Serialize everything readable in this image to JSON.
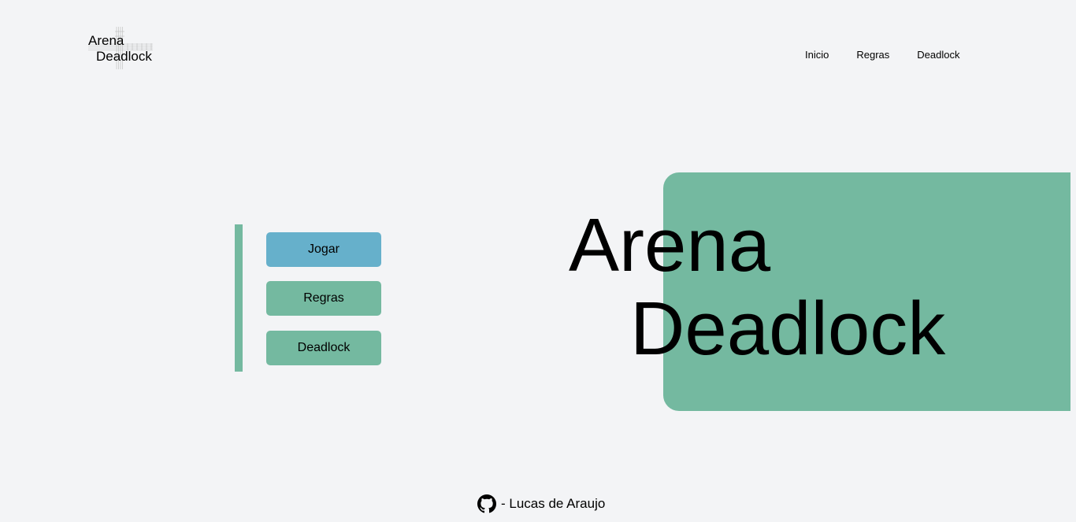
{
  "header": {
    "logo_line1": "Arena",
    "logo_line2": "Deadlock",
    "nav": [
      "Inicio",
      "Regras",
      "Deadlock"
    ]
  },
  "menu": {
    "buttons": [
      "Jogar",
      "Regras",
      "Deadlock"
    ]
  },
  "hero": {
    "line1": "Arena",
    "line2": "Deadlock"
  },
  "footer": {
    "credit": "- Lucas de Araujo",
    "icon": "github-icon"
  },
  "colors": {
    "background": "#f3f4f6",
    "green": "#74b9a0",
    "blue": "#66b0cb"
  }
}
